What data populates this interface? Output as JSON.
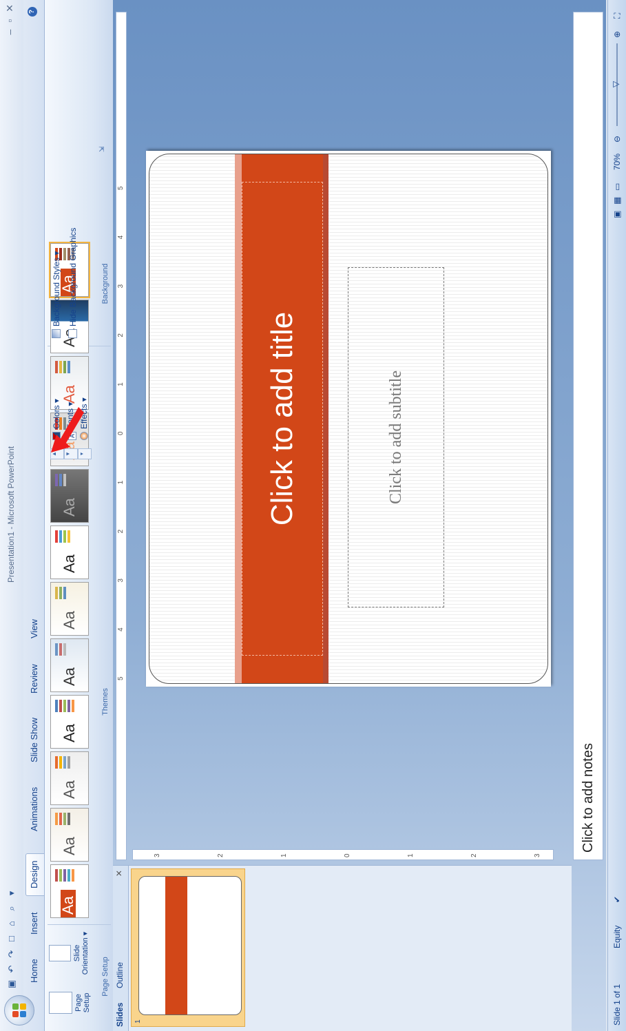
{
  "window": {
    "title": "Presentation1 - Microsoft PowerPoint",
    "controls": [
      "–",
      "▫",
      "✕"
    ]
  },
  "tabs": [
    "Home",
    "Insert",
    "Design",
    "Animations",
    "Slide Show",
    "Review",
    "View"
  ],
  "active_tab": "Design",
  "ribbon": {
    "page_setup": {
      "group_label": "Page Setup",
      "page_setup_label": "Page Setup",
      "orientation_label": "Slide Orientation ▾"
    },
    "themes": {
      "group_label": "Themes",
      "thumb_text": "Aa"
    },
    "theme_options": {
      "colors": "Colors ▾",
      "fonts": "Fonts ▾",
      "effects": "Effects ▾"
    },
    "background": {
      "group_label": "Background",
      "styles": "Background Styles ▾",
      "hide_graphics": "Hide Background Graphics",
      "hide_graphics_checked": false
    }
  },
  "left_pane": {
    "tabs": [
      "Slides",
      "Outline"
    ],
    "active": "Slides",
    "close": "✕",
    "thumb_number": "1"
  },
  "slide": {
    "title_placeholder": "Click to add title",
    "subtitle_placeholder": "Click to add subtitle",
    "accent_color": "#d24718"
  },
  "notes": {
    "placeholder": "Click to add notes"
  },
  "ruler": {
    "horizontal": [
      "5",
      "4",
      "3",
      "2",
      "1",
      "0",
      "1",
      "2",
      "3",
      "4",
      "5"
    ],
    "vertical": [
      "3",
      "2",
      "1",
      "0",
      "1",
      "2",
      "3"
    ]
  },
  "status": {
    "slide_info": "Slide 1 of 1",
    "theme": "Equity",
    "zoom": "70%"
  }
}
